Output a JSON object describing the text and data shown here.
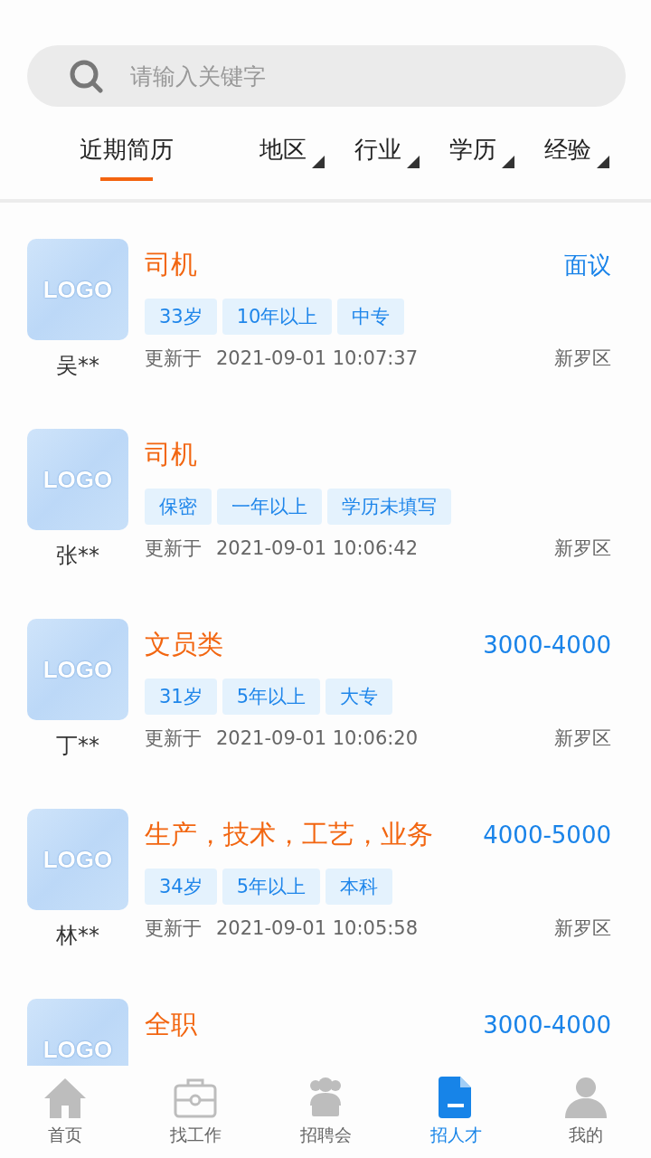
{
  "search": {
    "placeholder": "请输入关键字"
  },
  "tabs": [
    {
      "label": "近期简历",
      "kind": "plain",
      "selected": true
    },
    {
      "label": "地区",
      "kind": "dropdown",
      "selected": false
    },
    {
      "label": "行业",
      "kind": "dropdown",
      "selected": false
    },
    {
      "label": "学历",
      "kind": "dropdown",
      "selected": false
    },
    {
      "label": "经验",
      "kind": "dropdown",
      "selected": false
    }
  ],
  "resumes": [
    {
      "logo_text": "LOGO",
      "name": "吴**",
      "title": "司机",
      "salary": "面议",
      "tags": [
        "33岁",
        "10年以上",
        "中专"
      ],
      "updated_label": "更新于",
      "updated": "2021-09-01 10:07:37",
      "area": "新罗区"
    },
    {
      "logo_text": "LOGO",
      "name": "张**",
      "title": "司机",
      "tags": [
        "保密",
        "一年以上",
        "学历未填写"
      ],
      "updated_label": "更新于",
      "updated": "2021-09-01 10:06:42",
      "area": "新罗区"
    },
    {
      "logo_text": "LOGO",
      "name": "丁**",
      "title": "文员类",
      "salary": "3000-4000",
      "tags": [
        "31岁",
        "5年以上",
        "大专"
      ],
      "updated_label": "更新于",
      "updated": "2021-09-01 10:06:20",
      "area": "新罗区"
    },
    {
      "logo_text": "LOGO",
      "name": "林**",
      "title": "生产，技术，工艺，业务",
      "salary": "4000-5000",
      "tags": [
        "34岁",
        "5年以上",
        "本科"
      ],
      "updated_label": "更新于",
      "updated": "2021-09-01 10:05:58",
      "area": "新罗区"
    },
    {
      "logo_text": "LOGO",
      "title": "全职",
      "salary": "3000-4000"
    }
  ],
  "nav": [
    {
      "label": "首页",
      "kind": "home",
      "selected": false
    },
    {
      "label": "找工作",
      "kind": "briefcase",
      "selected": false
    },
    {
      "label": "招聘会",
      "kind": "people",
      "selected": false
    },
    {
      "label": "招人才",
      "kind": "document",
      "selected": true
    },
    {
      "label": "我的",
      "kind": "person",
      "selected": false
    }
  ]
}
